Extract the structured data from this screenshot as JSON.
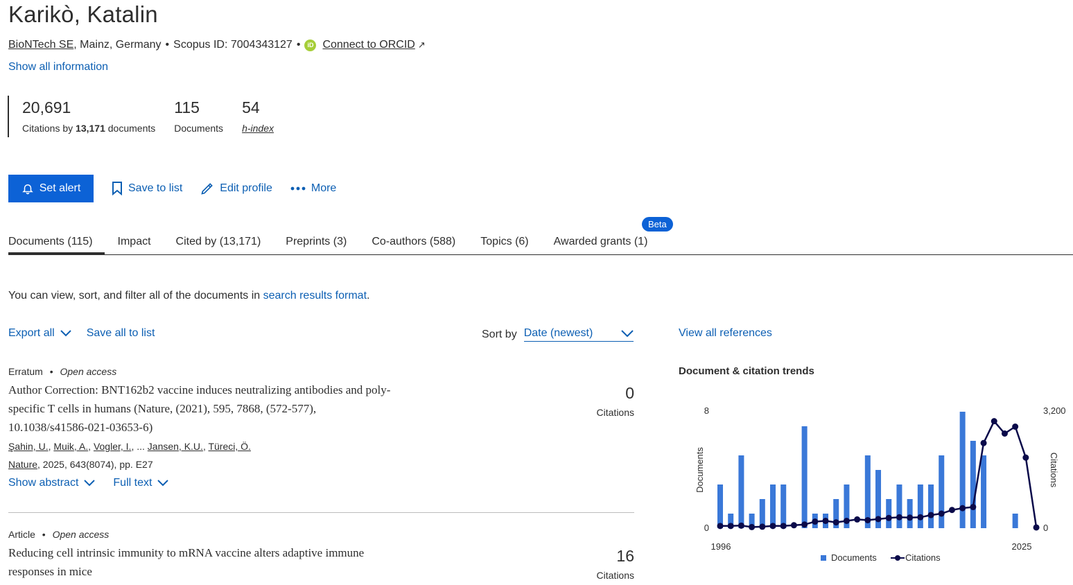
{
  "author": {
    "name": "Karikò, Katalin",
    "affiliation_name": "BioNTech SE",
    "affiliation_location": ", Mainz, Germany",
    "scopus_id": "Scopus ID: 7004343127",
    "orcid_label": "Connect to ORCID",
    "show_all": "Show all information"
  },
  "metrics": {
    "citations": "20,691",
    "citations_label_pre": "Citations by",
    "citations_label_docs": "13,171",
    "citations_label_post": "documents",
    "documents": "115",
    "documents_label": "Documents",
    "hindex": "54",
    "hindex_label": "h-index"
  },
  "actions": {
    "set_alert": "Set alert",
    "save_to_list": "Save to list",
    "edit_profile": "Edit profile",
    "more": "More"
  },
  "tabs": [
    {
      "label": "Documents (115)"
    },
    {
      "label": "Impact"
    },
    {
      "label": "Cited by (13,171)"
    },
    {
      "label": "Preprints (3)"
    },
    {
      "label": "Co-authors (588)"
    },
    {
      "label": "Topics (6)"
    },
    {
      "label": "Awarded grants (1)"
    }
  ],
  "beta_badge": "Beta",
  "view_note": {
    "pre": "You can view, sort, and filter all of the documents in",
    "link": "search results format",
    "post": "."
  },
  "toolbar": {
    "export_all": "Export all",
    "save_all": "Save all to list",
    "sort_label": "Sort by",
    "sort_value": "Date (newest)",
    "view_refs": "View all references"
  },
  "documents": [
    {
      "type": "Erratum",
      "access": "Open access",
      "title": "Author Correction: BNT162b2 vaccine induces neutralizing antibodies and poly-specific T cells in humans (Nature, (2021), 595, 7868, (572-577), 10.1038/s41586-021-03653-6)",
      "authors": [
        "Şahin, U.",
        "Muik, A.",
        "Vogler, I.",
        "Jansen, K.U.",
        "Türeci, Ö."
      ],
      "ellipsis": "...",
      "journal": "Nature",
      "source_rest": ", 2025, 643(8074), pp. E27",
      "citations": "0",
      "citations_label": "Citations",
      "show_abstract": "Show abstract",
      "full_text": "Full text"
    },
    {
      "type": "Article",
      "access": "Open access",
      "title": "Reducing cell intrinsic immunity to mRNA vaccine alters adaptive immune responses in mice",
      "citations": "16",
      "citations_label": "Citations"
    }
  ],
  "chart_data": {
    "type": "bar",
    "title": "Document & citation trends",
    "x_start_label": "1996",
    "x_end_label": "2025",
    "years": [
      1996,
      1997,
      1998,
      1999,
      2000,
      2001,
      2002,
      2003,
      2004,
      2005,
      2006,
      2007,
      2008,
      2009,
      2010,
      2011,
      2012,
      2013,
      2014,
      2015,
      2016,
      2017,
      2018,
      2019,
      2020,
      2021,
      2022,
      2023,
      2024,
      2025
    ],
    "series": [
      {
        "name": "Documents",
        "axis": "left",
        "values": [
          3,
          1,
          5,
          1,
          2,
          3,
          3,
          0,
          7,
          1,
          1,
          2,
          3,
          0,
          5,
          4,
          2,
          3,
          2,
          3,
          3,
          5,
          0,
          8,
          6,
          5,
          0,
          0,
          1,
          0
        ],
        "color": "#3a78d8"
      },
      {
        "name": "Citations",
        "axis": "right",
        "values": [
          60,
          60,
          70,
          30,
          40,
          60,
          60,
          80,
          100,
          180,
          200,
          160,
          200,
          240,
          220,
          250,
          280,
          300,
          290,
          300,
          360,
          400,
          500,
          550,
          580,
          2340,
          2940,
          2600,
          2790,
          1940,
          20
        ],
        "color": "#0a0a4a"
      }
    ],
    "ylabel_left": "Documents",
    "ylabel_right": "Citations",
    "ylim_left": [
      0,
      8
    ],
    "ylim_right": [
      0,
      3200
    ],
    "ytick_left": [
      "0",
      "8"
    ],
    "ytick_right": [
      "0",
      "3,200"
    ],
    "legend_position": "bottom"
  }
}
